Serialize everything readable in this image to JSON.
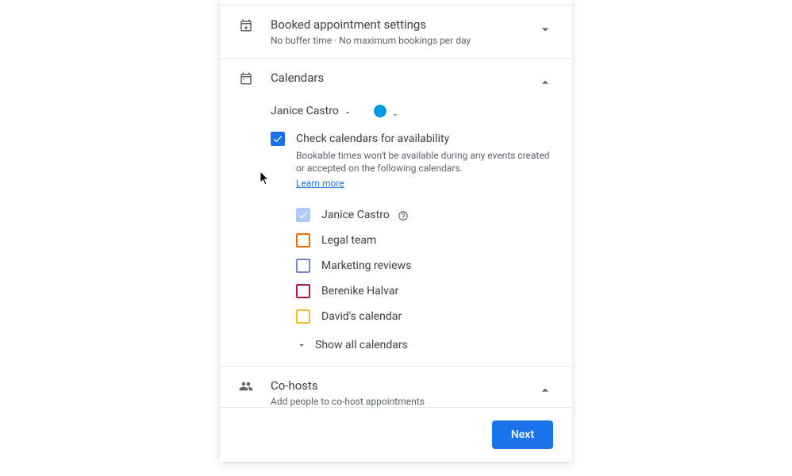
{
  "sections": {
    "booked": {
      "title": "Booked appointment settings",
      "subtitle": "No buffer time · No maximum bookings per day"
    },
    "calendars": {
      "title": "Calendars",
      "owner": "Janice Castro",
      "color": "#039be5",
      "check_availability": {
        "label": "Check calendars for availability",
        "desc": "Bookable times won't be available during any events created or accepted on the following calendars.",
        "learn_more": "Learn more"
      },
      "items": [
        {
          "label": "Janice Castro",
          "color": "#aecbfa",
          "checked": true,
          "disabled": true,
          "has_help": true
        },
        {
          "label": "Legal team",
          "color": "#ef6c00",
          "checked": false
        },
        {
          "label": "Marketing reviews",
          "color": "#7986cb",
          "checked": false
        },
        {
          "label": "Berenike Halvar",
          "color": "#ad1457",
          "checked": false
        },
        {
          "label": "David's calendar",
          "color": "#f6bf26",
          "checked": false
        }
      ],
      "show_all": "Show all calendars"
    },
    "cohosts": {
      "title": "Co-hosts",
      "subtitle": "Add people to co-host appointments"
    }
  },
  "footer": {
    "next": "Next"
  }
}
